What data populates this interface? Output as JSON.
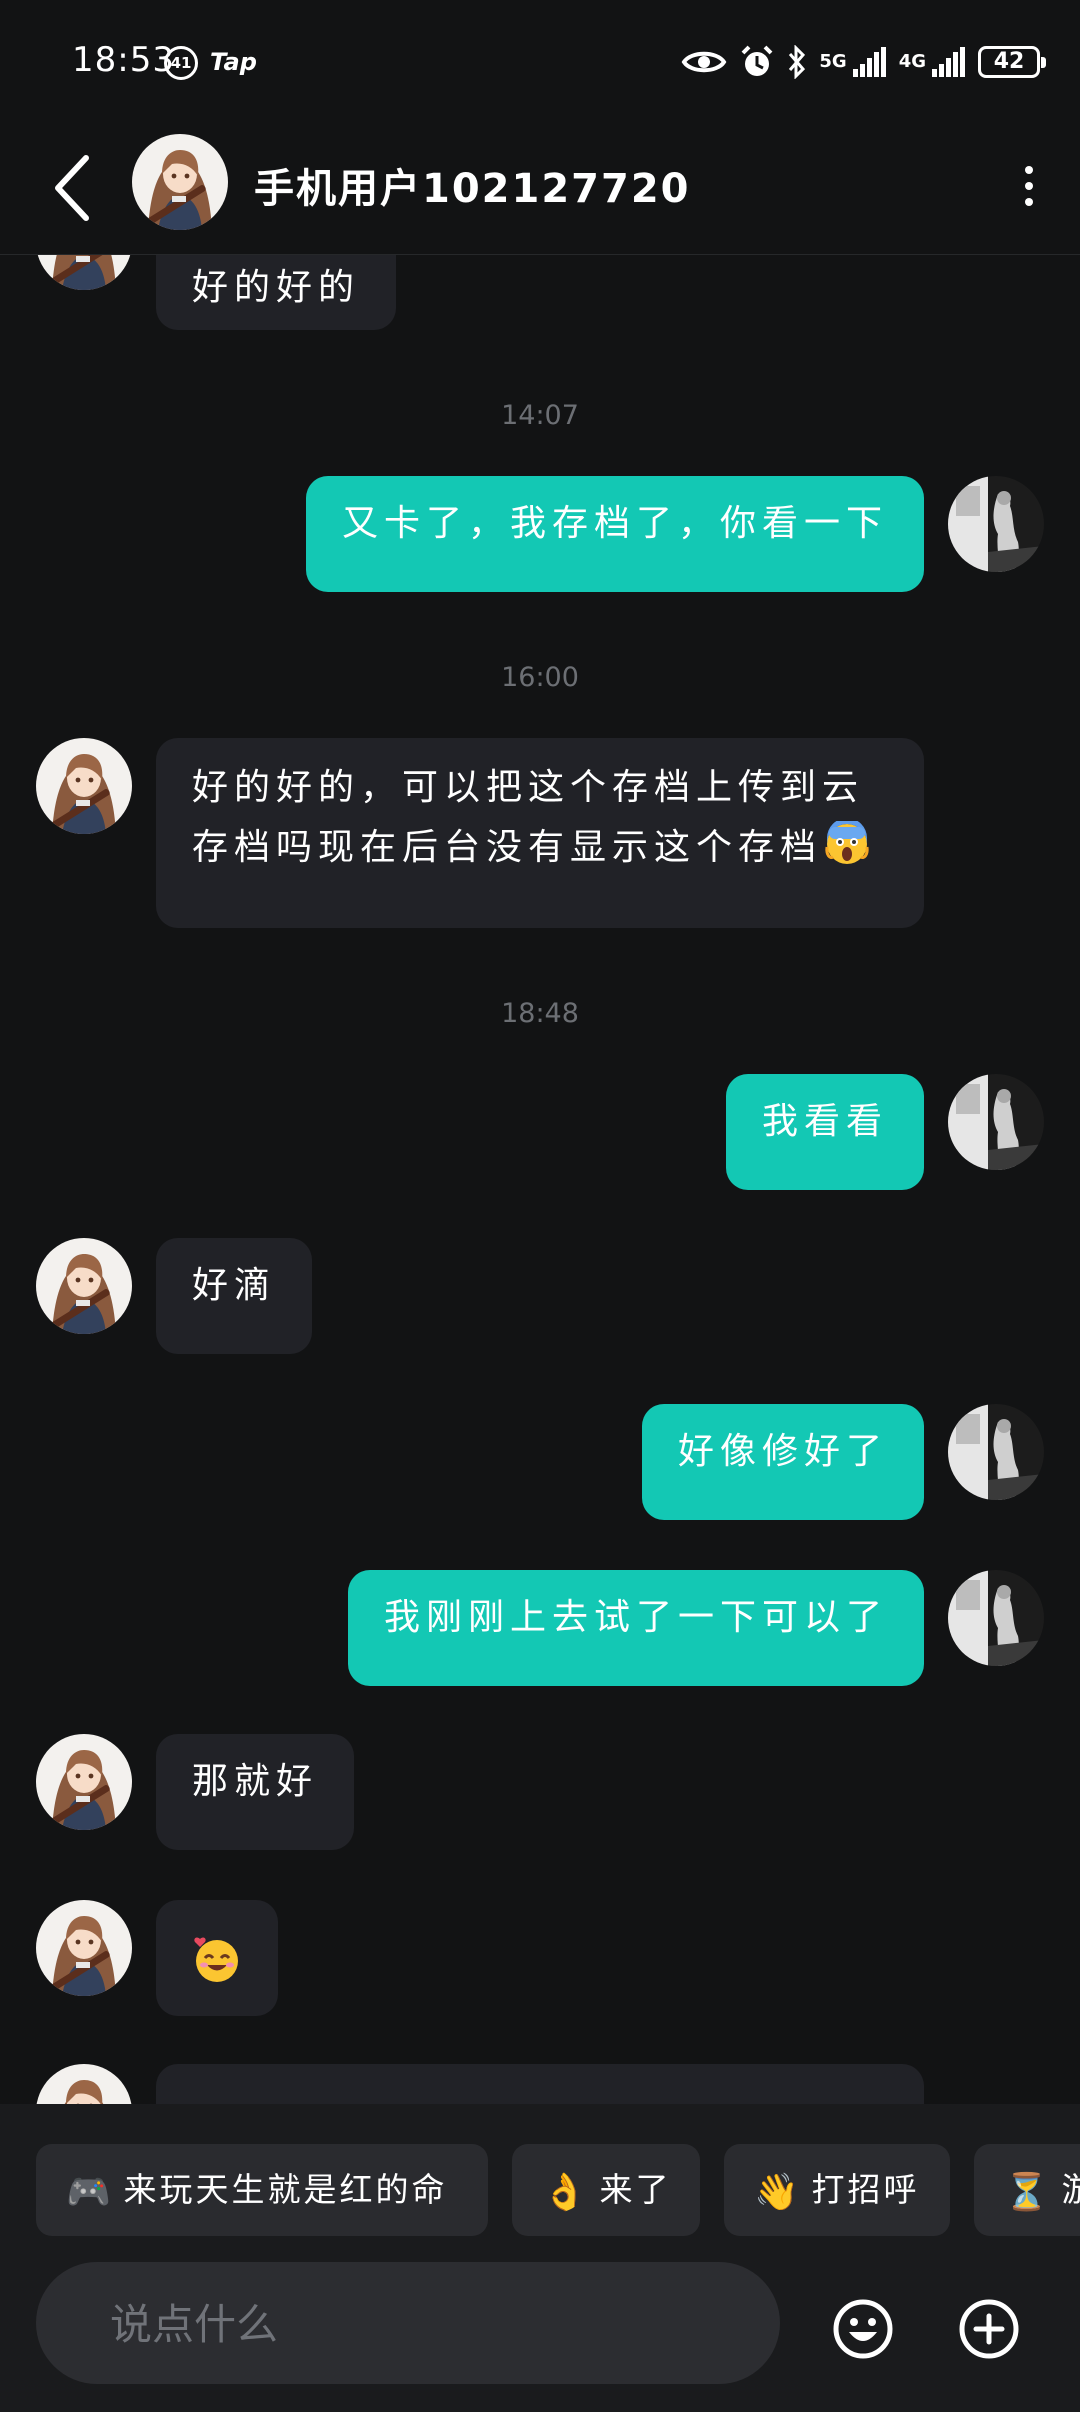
{
  "status_bar": {
    "time": "18:53",
    "notif_badge": "41",
    "app_label": "Tap",
    "net_5g": "5G",
    "net_4g": "4G",
    "battery": "42"
  },
  "header": {
    "contact_name": "手机用户102127720"
  },
  "messages": {
    "m0": "好的好的",
    "t1": "14:07",
    "m1": "又卡了，我存档了，你看一下",
    "t2": "16:00",
    "m2_line1": "好的好的，可以把这个存档上传到云",
    "m2_line2": "存档吗现在后台没有显示这个存档",
    "t3": "18:48",
    "m3": "我看看",
    "m4": "好滴",
    "m5": "好像修好了",
    "m6": "我刚刚上去试了一下可以了",
    "m7": "那就好"
  },
  "quick_replies": [
    {
      "icon": "🎮",
      "label": "来玩天生就是红的命"
    },
    {
      "icon": "👌",
      "label": "来了"
    },
    {
      "icon": "👋",
      "label": "打招呼"
    },
    {
      "icon": "⏳",
      "label": "游"
    }
  ],
  "composer": {
    "placeholder": "说点什么"
  },
  "colors": {
    "background": "#121314",
    "incoming_bubble": "#212227",
    "outgoing_bubble": "#13c8b4",
    "timestamp": "#6c6f74"
  },
  "icons": {
    "back": "chevron-left-icon",
    "more": "more-vertical-icon",
    "emoji": "smiley-icon",
    "add": "plus-circle-icon",
    "eye": "eye-icon",
    "alarm": "alarm-icon",
    "bluetooth": "bluetooth-icon"
  }
}
